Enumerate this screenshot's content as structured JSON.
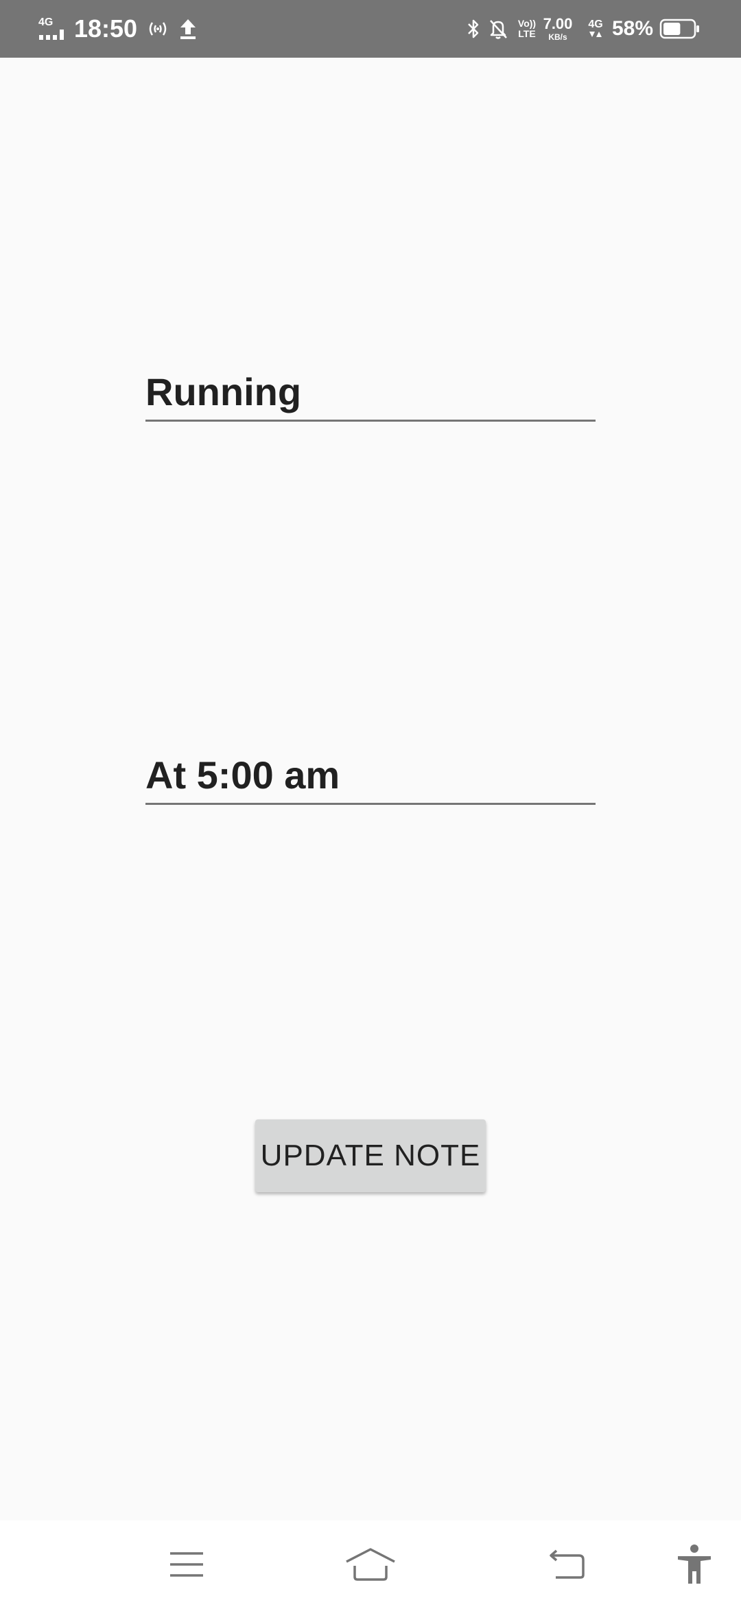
{
  "status_bar": {
    "network_label": "4G",
    "time": "18:50",
    "volte_top": "Vo))",
    "volte_bottom": "LTE",
    "speed_value": "7.00",
    "speed_unit": "KB/s",
    "network2_label": "4G",
    "battery_percent": "58%",
    "battery_level": 0.58,
    "icons": [
      "signal-icon",
      "hotspot-icon",
      "upload-icon",
      "bluetooth-icon",
      "bell-off-icon",
      "battery-icon"
    ]
  },
  "note": {
    "title": "Running",
    "time": "At 5:00 am"
  },
  "update_button": {
    "label": "UPDATE NOTE"
  },
  "nav_bar": {
    "icons": [
      "menu-icon",
      "home-icon",
      "back-icon",
      "accessibility-icon"
    ]
  },
  "colors": {
    "status_bar": "#757575",
    "background": "#fafafa",
    "text": "#212121",
    "underline": "#757575",
    "button": "#d6d7d7",
    "nav_icon": "#757575"
  }
}
